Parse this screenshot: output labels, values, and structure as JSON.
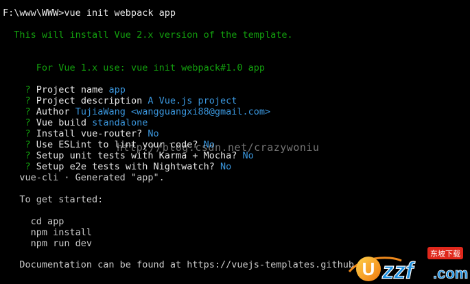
{
  "terminal": {
    "command_line": "F:\\www\\WWW>vue init webpack app",
    "info_line_1": "  This will install Vue 2.x version of the template.",
    "info_line_2_label": "  For Vue 1.x use: ",
    "info_line_2_cmd": "vue init webpack#1.0 app",
    "prompts": [
      {
        "label": "Project name ",
        "answer": "app"
      },
      {
        "label": "Project description ",
        "answer": "A Vue.js project"
      },
      {
        "label": "Author ",
        "answer": "TujiaWang <wangguangxi88@gmail.com>"
      },
      {
        "label": "Vue build ",
        "answer": "standalone"
      },
      {
        "label": "Install vue-router? ",
        "answer": "No"
      },
      {
        "label": "Use ESLint to lint your code? ",
        "answer": "No"
      },
      {
        "label": "Setup unit tests with Karma + Mocha? ",
        "answer": "No"
      },
      {
        "label": "Setup e2e tests with Nightwatch? ",
        "answer": "No"
      }
    ],
    "question_mark": "?",
    "generated_line": "   vue-cli · Generated \"app\".",
    "started_line": "   To get started:",
    "steps": [
      "     cd app",
      "     npm install",
      "     npm run dev"
    ],
    "docs_line": "   Documentation can be found at https://vuejs-templates.github"
  },
  "watermark": {
    "text": "http://blog.csdn.net/crazywoniu"
  },
  "logo": {
    "brand": "uzzf",
    "tagline": "东坡下载",
    "domain": ".com",
    "colors": {
      "orange": "#f08a1c",
      "blue": "#1a8fe0",
      "red": "#e0281c"
    }
  }
}
